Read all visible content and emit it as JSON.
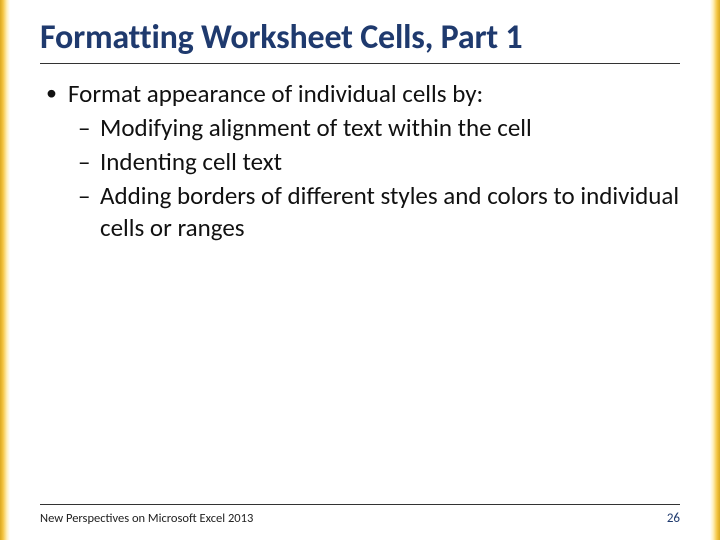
{
  "title": "Formatting Worksheet Cells, Part 1",
  "bullets": {
    "lvl1": "Format appearance of individual cells by:",
    "sub1": "Modifying alignment of text within the cell",
    "sub2": "Indenting cell text",
    "sub3": "Adding borders of different styles and colors to individual cells or ranges"
  },
  "footer": {
    "text": "New Perspectives on Microsoft Excel 2013",
    "page": "26"
  }
}
